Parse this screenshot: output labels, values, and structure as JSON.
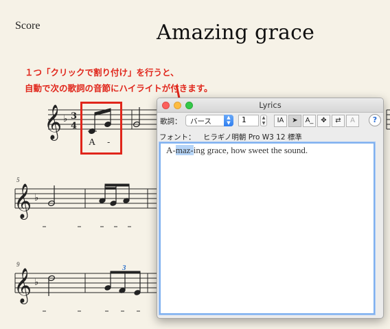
{
  "score": {
    "label": "Score",
    "title": "Amazing grace",
    "measure_numbers": [
      "5",
      "9"
    ],
    "triplet_mark": "3",
    "first_lyric": "A",
    "lyric_dash": "-"
  },
  "annotation": {
    "line1": "１つ「クリックで割り付け」を行うと、",
    "line2": "自動で次の歌詞の音節にハイライトが付きます。",
    "color": "#e0261b"
  },
  "lyrics_window": {
    "title": "Lyrics",
    "lyrics_label": "歌詞：",
    "verse_select_value": "バース",
    "verse_number": "1",
    "font_label": "フォント：",
    "font_value": "ヒラギノ明朝 Pro W3 12 標準",
    "lyric_before": "A-",
    "lyric_selected": "maz-",
    "lyric_after": "ing grace, how sweet the sound.",
    "tool_icons": [
      "text-size-icon",
      "pointer-arrow-icon",
      "underscore-A-icon",
      "move-cross-icon",
      "swap-arrows-icon",
      "outline-A-icon"
    ],
    "tool_labels": [
      "IA",
      "➤",
      "A_",
      "✥",
      "⇄",
      "A"
    ],
    "help_label": "?"
  }
}
